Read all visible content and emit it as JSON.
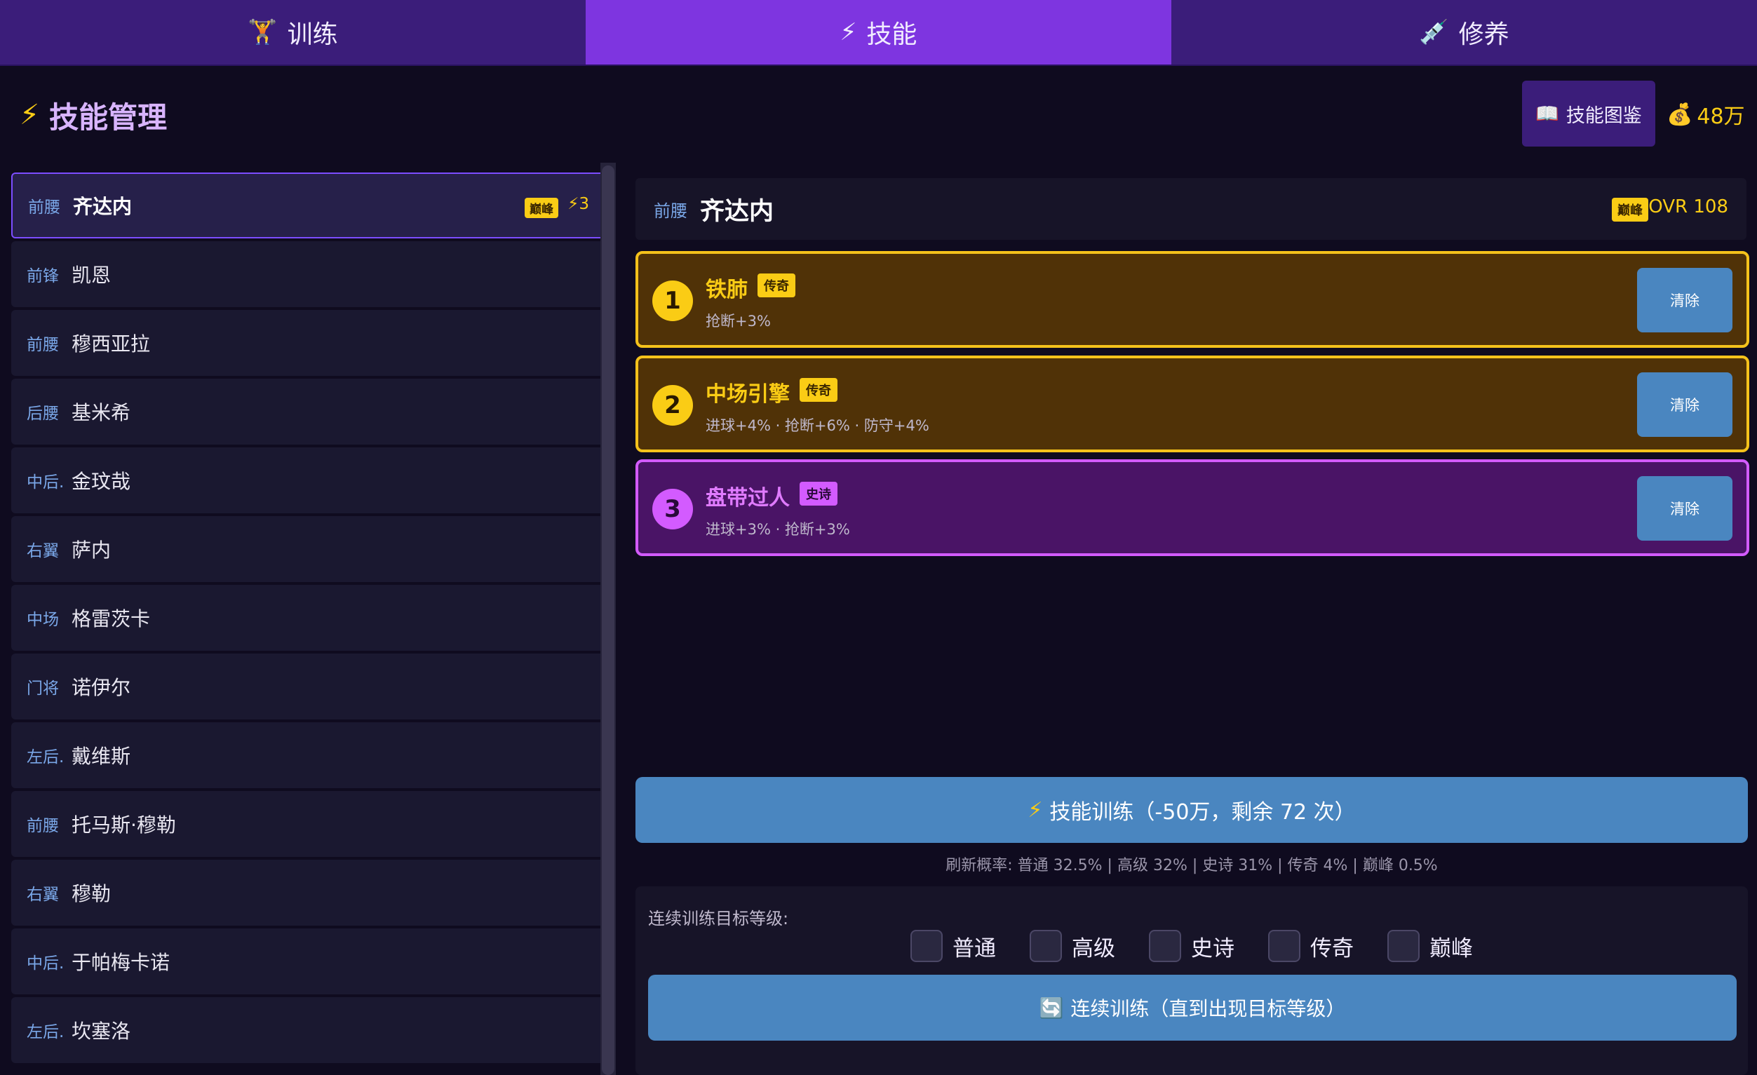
{
  "tabs": [
    {
      "icon": "🏋",
      "label": "训练",
      "active": false
    },
    {
      "icon": "⚡",
      "label": "技能",
      "active": true
    },
    {
      "icon": "💉",
      "label": "修养",
      "active": false
    }
  ],
  "header": {
    "title_icon": "⚡",
    "title": "技能管理",
    "dex_icon": "📖",
    "dex_label": "技能图鉴",
    "coin_icon": "💰",
    "coins": "48万"
  },
  "players": [
    {
      "pos": "前腰",
      "name": "齐达内",
      "tag": "巅峰",
      "count": "⚡3",
      "selected": true
    },
    {
      "pos": "前锋",
      "name": "凯恩"
    },
    {
      "pos": "前腰",
      "name": "穆西亚拉"
    },
    {
      "pos": "后腰",
      "name": "基米希"
    },
    {
      "pos": "中后.",
      "name": "金玟哉"
    },
    {
      "pos": "右翼",
      "name": "萨内"
    },
    {
      "pos": "中场",
      "name": "格雷茨卡"
    },
    {
      "pos": "门将",
      "name": "诺伊尔"
    },
    {
      "pos": "左后.",
      "name": "戴维斯"
    },
    {
      "pos": "前腰",
      "name": "托马斯·穆勒"
    },
    {
      "pos": "右翼",
      "name": "穆勒"
    },
    {
      "pos": "中后.",
      "name": "于帕梅卡诺"
    },
    {
      "pos": "左后.",
      "name": "坎塞洛"
    }
  ],
  "detail": {
    "pos": "前腰",
    "name": "齐达内",
    "tag": "巅峰",
    "ovr": "OVR 108"
  },
  "skills": [
    {
      "num": "1",
      "name": "铁肺",
      "rarity": "传奇",
      "type": "legend",
      "effects": "抢断+3%",
      "clear": "清除"
    },
    {
      "num": "2",
      "name": "中场引擎",
      "rarity": "传奇",
      "type": "legend",
      "effects": "进球+4% · 抢断+6% · 防守+4%",
      "clear": "清除"
    },
    {
      "num": "3",
      "name": "盘带过人",
      "rarity": "史诗",
      "type": "epic",
      "effects": "进球+3% · 抢断+3%",
      "clear": "清除"
    }
  ],
  "training": {
    "icon": "⚡",
    "label": "技能训练（-50万，剩余 72 次）",
    "prob": "刷新概率: 普通 32.5% | 高级 32% | 史诗 31% | 传奇 4% | 巅峰 0.5%"
  },
  "continuous": {
    "label": "连续训练目标等级:",
    "levels": [
      "普通",
      "高级",
      "史诗",
      "传奇",
      "巅峰"
    ],
    "button_icon": "🔄",
    "button": "连续训练（直到出现目标等级）"
  }
}
